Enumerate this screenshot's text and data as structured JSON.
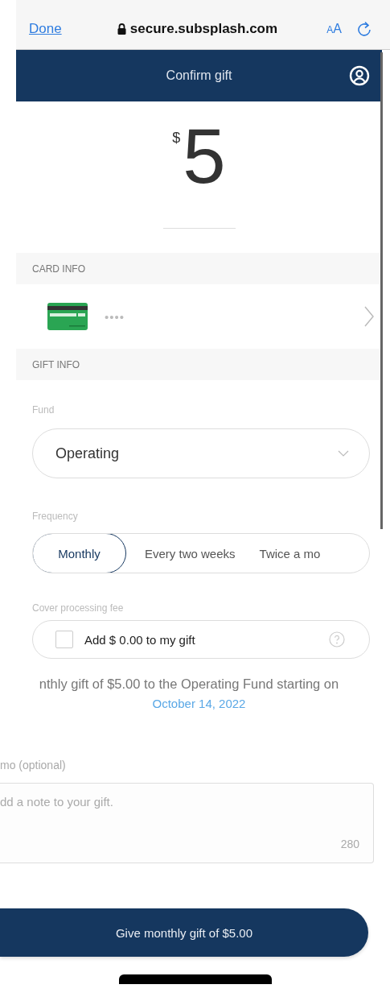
{
  "browser_bar": {
    "done": "Done",
    "url": "secure.subsplash.com",
    "text_size": "AA"
  },
  "header": {
    "title": "Confirm gift"
  },
  "amount": {
    "currency": "$",
    "value": "5"
  },
  "card_info": {
    "heading": "CARD INFO",
    "masked_number": "••••"
  },
  "gift_info": {
    "heading": "GIFT INFO",
    "fund": {
      "label": "Fund",
      "value": "Operating"
    },
    "frequency": {
      "label": "Frequency",
      "options": [
        {
          "label": "Monthly",
          "selected": true
        },
        {
          "label": "Every two weeks",
          "selected": false
        },
        {
          "label": "Twice a mo",
          "selected": false
        }
      ]
    },
    "processing_fee": {
      "label": "Cover processing fee",
      "text": "Add $ 0.00 to my gift",
      "checked": false
    }
  },
  "summary": {
    "text": "nthly gift of $5.00 to the Operating Fund starting on",
    "date": "October 14, 2022"
  },
  "memo": {
    "label": "mo (optional)",
    "placeholder": "dd a note to your gift.",
    "counter": "280"
  },
  "submit": {
    "label": "Give monthly gift of $5.00"
  }
}
